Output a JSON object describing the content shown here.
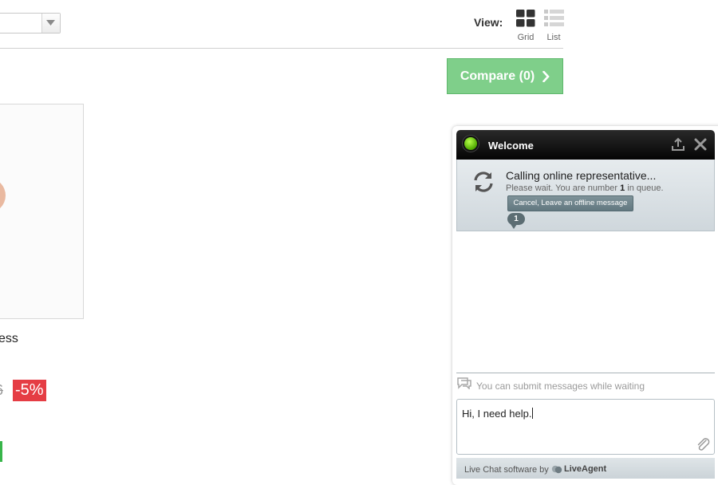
{
  "toolbar": {
    "view_label": "View:",
    "grid_label": "Grid",
    "list_label": "List",
    "sort_value": ""
  },
  "compare": {
    "label": "Compare (0)"
  },
  "product": {
    "name_partial": "ess",
    "old_price_partial": "6",
    "discount": "-5%"
  },
  "chat": {
    "title": "Welcome",
    "calling_text": "Calling online representative...",
    "queue_before": "Please wait. You are number ",
    "queue_number": "1",
    "queue_after": " in queue.",
    "cancel_label": "Cancel, Leave an offline message",
    "bubble_count": "1",
    "hint": "You can submit messages while waiting",
    "input_value": "Hi, I need help.",
    "footer_text": "Live Chat software by",
    "brand": "LiveAgent"
  },
  "colors": {
    "compare_green": "#7fcf8a",
    "discount_red": "#e53d44",
    "status_green": "#4ea800",
    "chat_header": "#050505"
  }
}
